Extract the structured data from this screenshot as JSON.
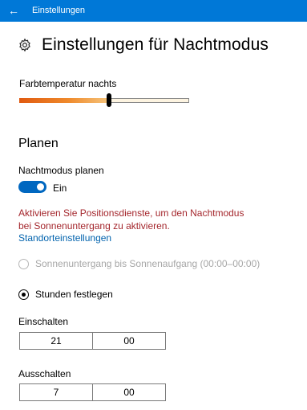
{
  "window": {
    "title": "Einstellungen",
    "back_icon": "back-arrow-icon"
  },
  "page": {
    "title": "Einstellungen für Nachtmodus",
    "icon": "gear-icon"
  },
  "color_temperature": {
    "label": "Farbtemperatur nachts",
    "value_fraction": 0.53
  },
  "schedule": {
    "heading": "Planen",
    "toggle_label": "Nachtmodus planen",
    "toggle_state": "Ein",
    "toggle_on": true,
    "warning": "Aktivieren Sie Positionsdienste, um den Nachtmodus bei Sonnenuntergang zu aktivieren.",
    "location_link": "Standorteinstellungen",
    "option_sunset": "Sonnenuntergang bis Sonnenaufgang (00:00–00:00)",
    "option_hours": "Stunden festlegen"
  },
  "turn_on": {
    "label": "Einschalten",
    "hour": "21",
    "minute": "00"
  },
  "turn_off": {
    "label": "Ausschalten",
    "hour": "7",
    "minute": "00"
  },
  "colors": {
    "accent": "#0078d7",
    "warning": "#a4262c",
    "link": "#0062ad"
  }
}
